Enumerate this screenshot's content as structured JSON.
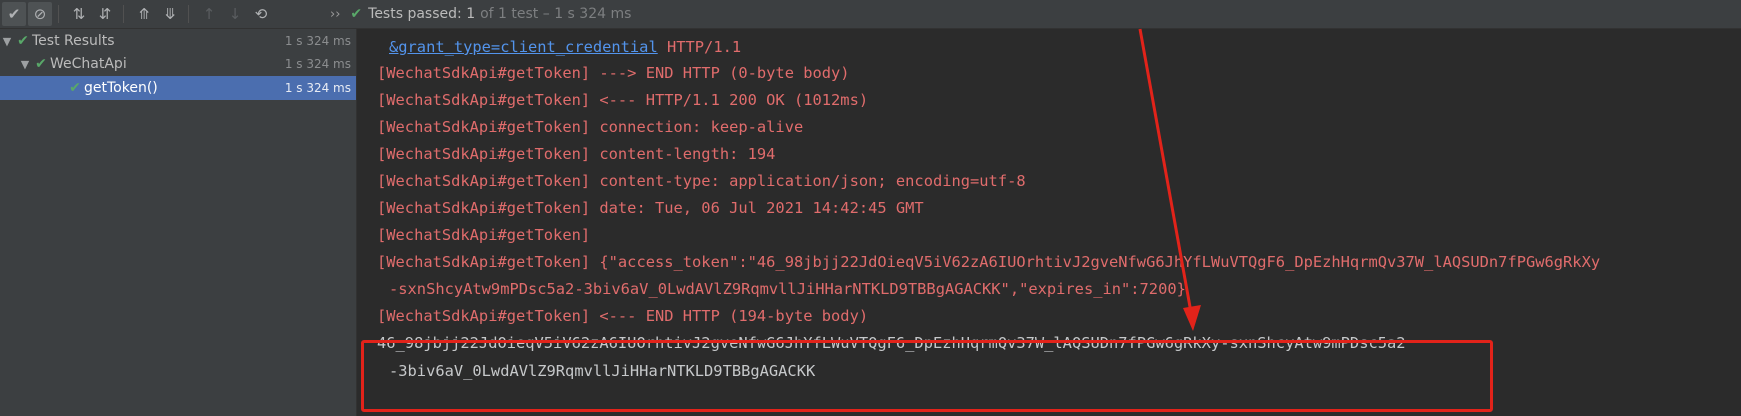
{
  "toolbar": {
    "buttons": [
      {
        "icon": "check-icon",
        "glyph": "✔",
        "active": true
      },
      {
        "icon": "stop-circle-icon",
        "glyph": "⊘",
        "active": true
      },
      {
        "icon": "sort-alpha-icon",
        "glyph": "⇅"
      },
      {
        "icon": "sort-duration-icon",
        "glyph": "⇵"
      },
      {
        "icon": "expand-all-icon",
        "glyph": "⤊"
      },
      {
        "icon": "collapse-all-icon",
        "glyph": "⤋"
      },
      {
        "icon": "previous-failed-icon",
        "glyph": "↑",
        "disabled": true
      },
      {
        "icon": "next-failed-icon",
        "glyph": "↓",
        "disabled": true
      },
      {
        "icon": "history-icon",
        "glyph": "⟲"
      }
    ]
  },
  "status": {
    "label": "Tests passed:",
    "count": "1",
    "detail": "of 1 test – 1 s 324 ms"
  },
  "tree": {
    "items": [
      {
        "label": "Test Results",
        "time": "1 s 324 ms"
      },
      {
        "label": "WeChatApi",
        "time": "1 s 324 ms"
      },
      {
        "label": "getToken()",
        "time": "1 s 324 ms"
      }
    ]
  },
  "console": {
    "lines": [
      {
        "link": "&grant_type=client_credential",
        "rest": " HTTP/1.1"
      },
      {
        "text": "[WechatSdkApi#getToken] ---> END HTTP (0-byte body)"
      },
      {
        "text": "[WechatSdkApi#getToken] <--- HTTP/1.1 200 OK (1012ms)"
      },
      {
        "text": "[WechatSdkApi#getToken] connection: keep-alive"
      },
      {
        "text": "[WechatSdkApi#getToken] content-length: 194"
      },
      {
        "text": "[WechatSdkApi#getToken] content-type: application/json; encoding=utf-8"
      },
      {
        "text": "[WechatSdkApi#getToken] date: Tue, 06 Jul 2021 14:42:45 GMT"
      },
      {
        "text": "[WechatSdkApi#getToken]"
      },
      {
        "text": "[WechatSdkApi#getToken] {\"access_token\":\"46_98jbjj22JdOieqV5iV62zA6IUOrhtivJ2gveNfwG6JhYfLWuVTQgF6_DpEzhHqrmQv37W_lAQSUDn7fPGw6gRkXy"
      },
      {
        "text": "-sxnShcyAtw9mPDsc5a2-3biv6aV_0LwdAVlZ9RqmvllJiHHarNTKLD9TBBgAGACKK\",\"expires_in\":7200}"
      },
      {
        "text": "[WechatSdkApi#getToken] <--- END HTTP (194-byte body)"
      },
      {
        "text": "46_98jbjj22JdOieqV5iV62zA6IUOrhtivJ2gveNfwG6JhYfLWuVTQgF6_DpEzhHqrmQv37W_lAQSUDn7fPGw6gRkXy-sxnShcyAtw9mPDsc5a2"
      },
      {
        "text": "-3biv6aV_0LwdAVlZ9RqmvllJiHHarNTKLD9TBBgAGACKK"
      }
    ]
  },
  "colors": {
    "log_red": "#e06c6c",
    "token_text": "#c6c8ca",
    "link_blue": "#5394ec",
    "annotation_red": "#e2231a",
    "pass_green": "#59a869",
    "selection_blue": "#4b6eaf"
  }
}
